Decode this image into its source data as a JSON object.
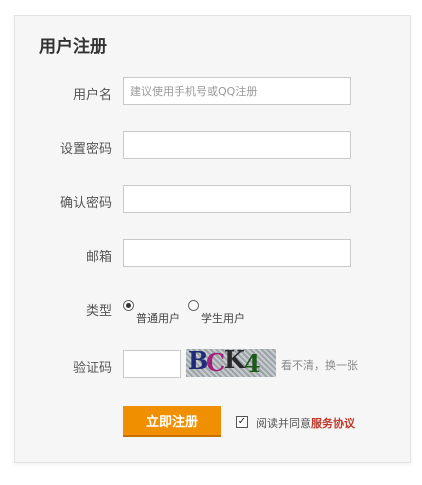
{
  "form": {
    "title": "用户注册",
    "username": {
      "label": "用户名",
      "placeholder": "建议使用手机号或QQ注册"
    },
    "password": {
      "label": "设置密码"
    },
    "confirm_password": {
      "label": "确认密码"
    },
    "email": {
      "label": "邮箱"
    },
    "type": {
      "label": "类型",
      "options": [
        {
          "label": "普通用户",
          "checked": true
        },
        {
          "label": "学生用户",
          "checked": false
        }
      ]
    },
    "captcha": {
      "label": "验证码",
      "image_text": "BCK4",
      "refresh_text": "看不清，换一张"
    },
    "submit_label": "立即注册",
    "agreement": {
      "text": "阅读并同意",
      "link": "服务协议",
      "checked": true,
      "check_mark": "✓"
    }
  },
  "colors": {
    "accent": "#f08f00",
    "link": "#c0392b"
  }
}
